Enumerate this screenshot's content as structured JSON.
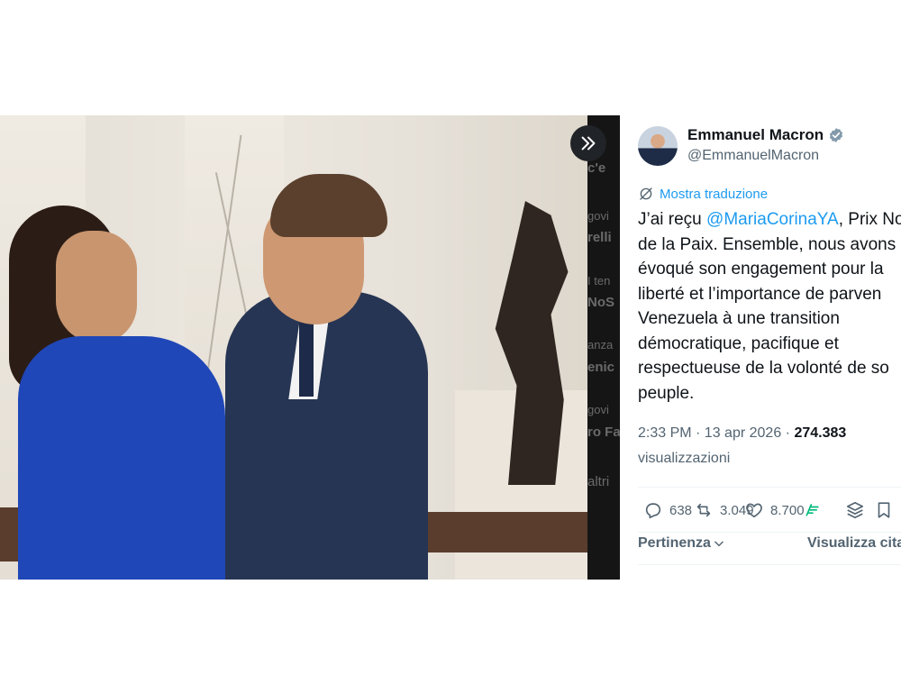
{
  "media": {
    "side_strip_texts": [
      "c'e",
      "govi",
      "relli",
      "I ten",
      "NoS",
      "anza",
      "enic",
      "govi",
      "ro Fa",
      "altri"
    ]
  },
  "author": {
    "name": "Emmanuel Macron",
    "handle": "@EmmanuelMacron",
    "verified_icon": "verified-badge-icon"
  },
  "translate_label": "Mostra traduzione",
  "tweet": {
    "line1_prefix": "J’ai reçu ",
    "mention": "@MariaCorinaYA",
    "line1_suffix": ", Prix No",
    "lines": [
      "de la Paix. Ensemble, nous avons",
      "évoqué son engagement pour la",
      "liberté et l’importance de parven",
      "Venezuela à une transition",
      "démocratique, pacifique et",
      "respectueuse de la volonté de so",
      "peuple."
    ]
  },
  "meta": {
    "time_date": "2:33 PM · 13 apr 2026 · ",
    "views_count": "274.383",
    "views_label": "visualizzazioni"
  },
  "actions": {
    "replies": "638",
    "reposts": "3.049",
    "likes": "8.700"
  },
  "replies_sort": {
    "label": "Pertinenza",
    "quotes_label": "Visualizza cita"
  },
  "colors": {
    "accent": "#1d9bf0",
    "text": "#0f1419",
    "secondary": "#536471",
    "grok_green": "#00ba7c"
  }
}
